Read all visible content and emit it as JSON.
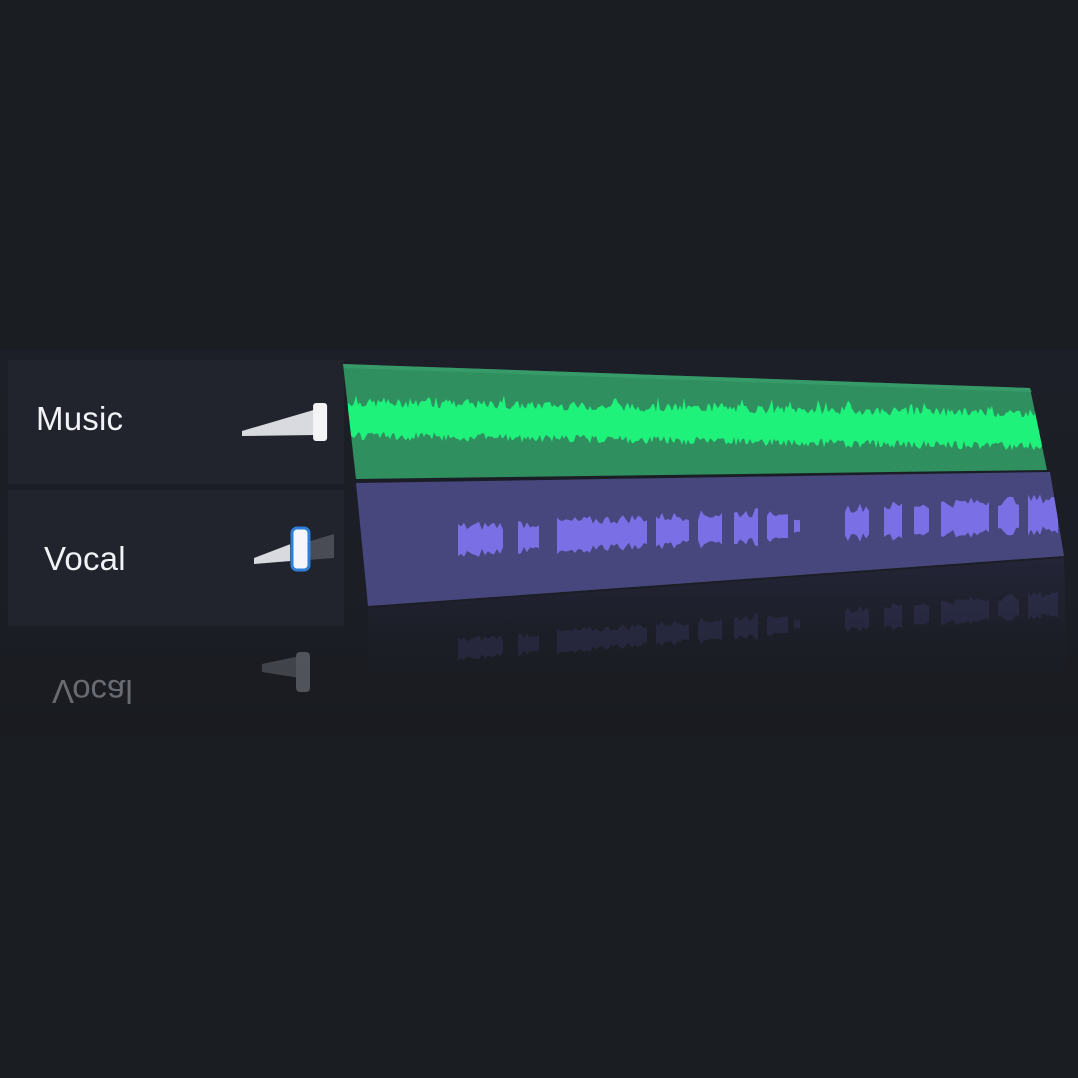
{
  "tracks": [
    {
      "name": "Music",
      "volume": 0.95,
      "clip_color": "#2f8f5f",
      "waveform_color": "#1ff27a",
      "selected": false
    },
    {
      "name": "Vocal",
      "volume": 0.45,
      "clip_color": "#47477e",
      "waveform_color": "#7b6fe6",
      "selected": true
    }
  ],
  "colors": {
    "background": "#1a1d21",
    "header_background": "#21232d",
    "slider_wedge": "#d9dadf",
    "selected_outline": "#2e7fd8"
  }
}
